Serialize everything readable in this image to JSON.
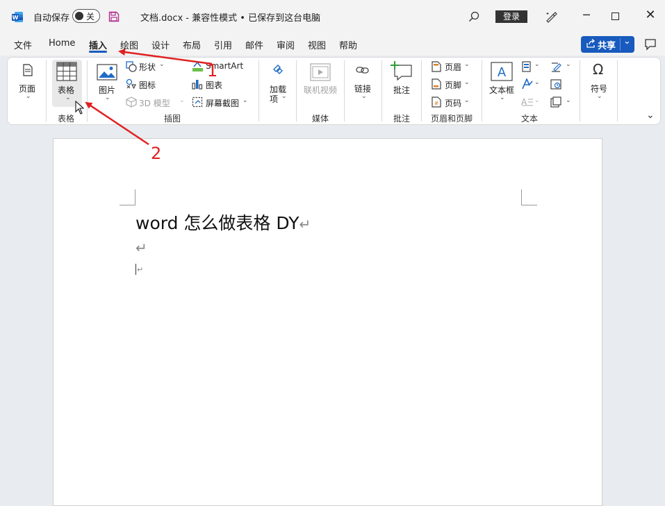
{
  "titlebar": {
    "autosave_label": "自动保存",
    "autosave_state": "关",
    "doc_title": "文档.docx  -  兼容性模式 • 已保存到这台电脑",
    "login_label": "登录"
  },
  "menu": {
    "items": [
      "文件",
      "Home",
      "插入",
      "绘图",
      "设计",
      "布局",
      "引用",
      "邮件",
      "审阅",
      "视图",
      "帮助"
    ],
    "active": "插入",
    "share_label": "共享"
  },
  "ribbon": {
    "page_label": "页面",
    "table_label": "表格",
    "table_group": "表格",
    "picture_label": "图片",
    "shapes_label": "形状",
    "icons_label": "图标",
    "model3d_label": "3D 模型",
    "smartart_label": "SmartArt",
    "chart_label": "图表",
    "screenshot_label": "屏幕截图",
    "illustrations_group": "插图",
    "addins_label1": "加载",
    "addins_label2": "项",
    "online_video_label": "联机视频",
    "media_group": "媒体",
    "link_label": "链接",
    "comment_label": "批注",
    "comment_group": "批注",
    "header_label": "页眉",
    "footer_label": "页脚",
    "page_number_label": "页码",
    "header_footer_group": "页眉和页脚",
    "textbox_label": "文本框",
    "text_group": "文本",
    "symbol_label": "符号"
  },
  "document": {
    "line1": "word 怎么做表格 DY"
  },
  "annotations": {
    "step1": "1",
    "step2": "2",
    "color": "#e02020"
  },
  "colors": {
    "accent": "#185abd",
    "word_blue": "#185abd"
  }
}
